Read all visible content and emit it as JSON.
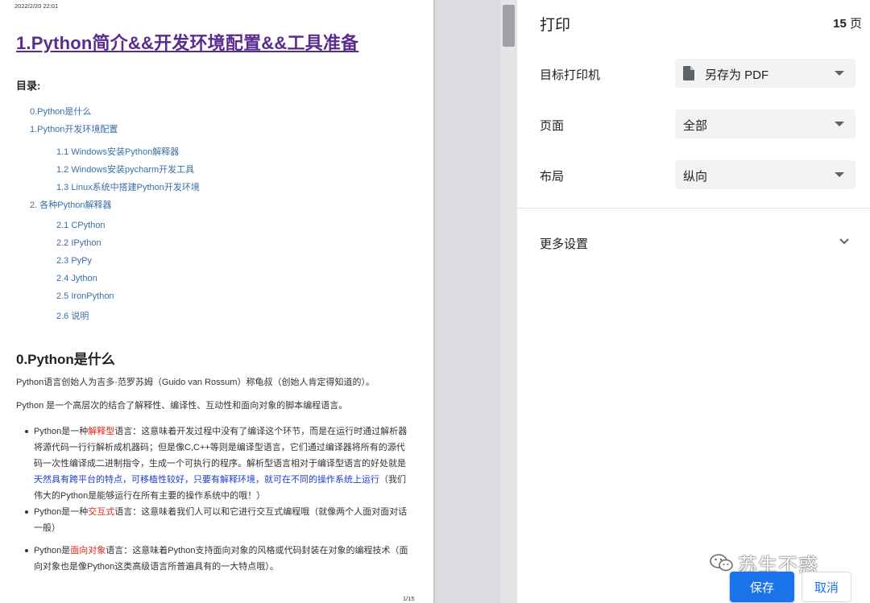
{
  "preview": {
    "timestamp": "2022/2/20 22:01",
    "doc_title": "1.Python简介&&开发环境配置&&工具准备",
    "toc_heading": "目录:",
    "toc": [
      "0.Python是什么",
      "1.Python开发环境配置",
      "1.1 Windows安装Python解释器",
      "1.2 Windows安装pycharm开发工具",
      "1.3 Linux系统中搭建Python开发环境",
      "2. 各种Python解释器",
      "2.1 CPython",
      "2.2 IPython",
      "2.3 PyPy",
      "2.4 Jython",
      "2.5 IronPython",
      "2.6 说明"
    ],
    "section_heading": "0.Python是什么",
    "para1": "Python语言创始人为吉多·范罗苏姆（Guido van Rossum）称龟叔（创始人肯定得知道的）。",
    "para2": "Python 是一个高层次的结合了解释性、编译性、互动性和面向对象的脚本编程语言。",
    "bullets": {
      "b1_pre": "Python是一种",
      "b1_hl": "解释型",
      "b1_mid": "语言：这意味着开发过程中没有了编译这个环节，而是在运行时通过解析器将源代码一行行解析成机器码；但是像C,C++等则是编译型语言，它们通过编译器将所有的源代码一次性编译成二进制指令，生成一个可执行的程序。解析型语言相对于编译型语言的好处就是",
      "b1_blue": "天然具有跨平台的特点，可移植性较好，只要有解释环境，就可在不同的操作系统上运行",
      "b1_post": "（我们伟大的Python是能够运行在所有主要的操作系统中的哦！）",
      "b2_pre": "Python是一种",
      "b2_hl": "交互式",
      "b2_post": "语言：这意味着我们人可以和它进行交互式编程哦（就像两个人面对面对话一般）",
      "b3_pre": "Python是",
      "b3_hl": "面向对象",
      "b3_post": "语言：这意味着Python支持面向对象的风格或代码封装在对象的编程技术（面向对象也是像Python这类高级语言所普遍具有的一大特点哦）。"
    },
    "page_number": "1/15"
  },
  "panel": {
    "title": "打印",
    "page_count": "15",
    "page_unit": "页",
    "destination_label": "目标打印机",
    "destination_value": "另存为 PDF",
    "pages_label": "页面",
    "pages_value": "全部",
    "layout_label": "布局",
    "layout_value": "纵向",
    "more_settings": "更多设置",
    "save_label": "保存",
    "cancel_label": "取消",
    "watermark": "苏生不惑"
  },
  "colors": {
    "accent": "#1a73e8",
    "title_link": "#5b2c8f",
    "toc_link": "#3a6fa6",
    "highlight_red": "#e2231a",
    "highlight_blue": "#1e3fcf"
  }
}
